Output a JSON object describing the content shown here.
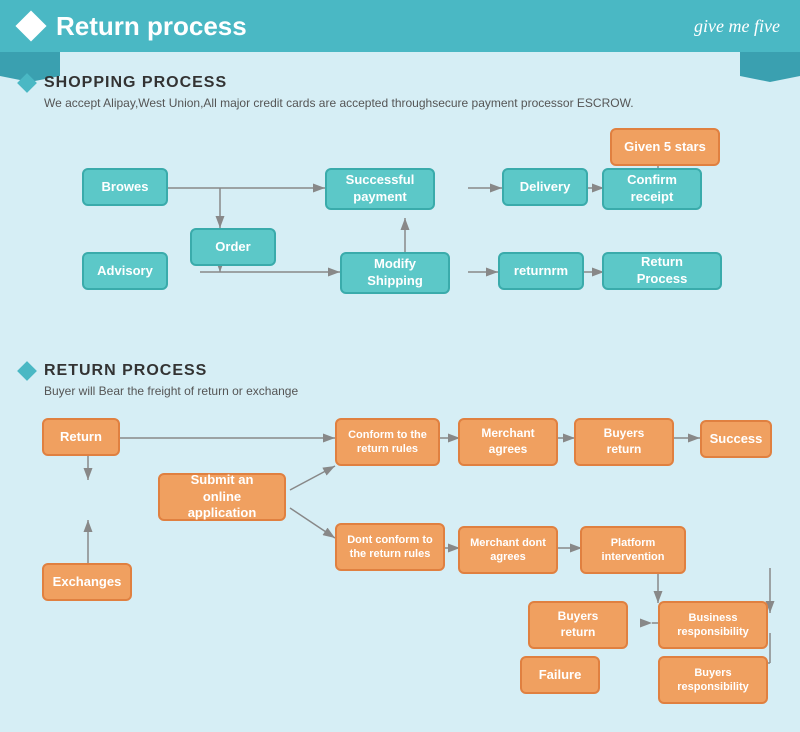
{
  "header": {
    "title": "Return process",
    "brand": "give me five"
  },
  "shopping": {
    "title": "SHOPPING PROCESS",
    "desc": "We accept Alipay,West Union,All major credit cards are accepted throughsecure payment processor ESCROW.",
    "boxes": {
      "browes": "Browes",
      "order": "Order",
      "advisory": "Advisory",
      "modify_shipping": "Modify Shipping",
      "successful_payment": "Successful payment",
      "delivery": "Delivery",
      "confirm_receipt": "Confirm receipt",
      "given_5_stars": "Given 5 stars",
      "returnrm": "returnrm",
      "return_process": "Return Process"
    }
  },
  "return": {
    "title": "RETURN PROCESS",
    "desc": "Buyer will Bear the freight of return or exchange",
    "boxes": {
      "return": "Return",
      "exchanges": "Exchanges",
      "submit": "Submit an online application",
      "conform_return": "Conform to the return rules",
      "dont_conform": "Dont conform to the return rules",
      "merchant_agrees": "Merchant agrees",
      "merchant_dont": "Merchant dont agrees",
      "buyers_return1": "Buyers return",
      "buyers_return2": "Buyers return",
      "platform": "Platform intervention",
      "success": "Success",
      "business_resp": "Business responsibility",
      "buyers_resp": "Buyers responsibility",
      "failure": "Failure"
    }
  }
}
